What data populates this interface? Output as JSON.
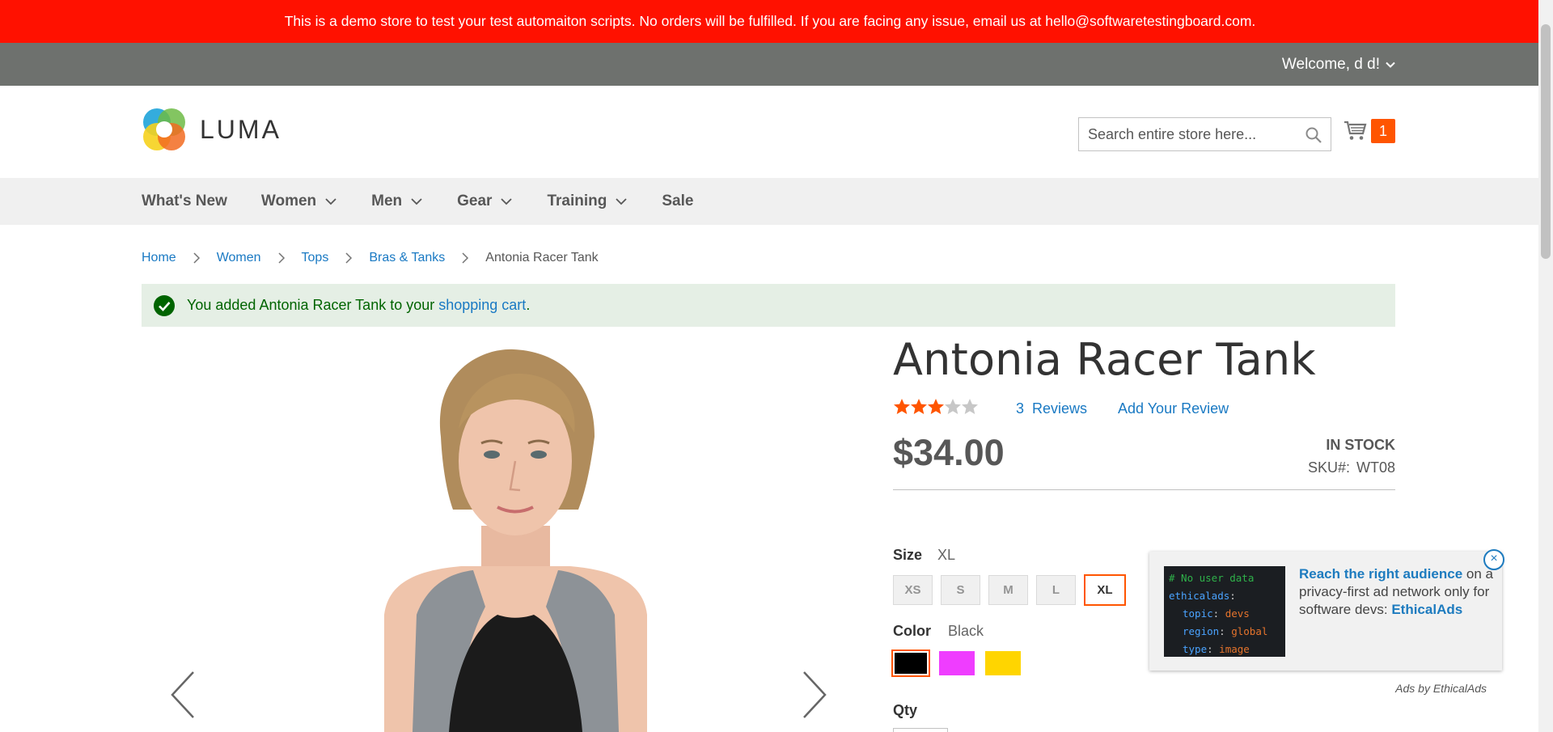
{
  "demo_notice": "This is a demo store to test your test automaiton scripts. No orders will be fulfilled. If you are facing any issue, email us at hello@softwaretestingboard.com.",
  "header": {
    "welcome": "Welcome, d d!",
    "logo_text": "LUMA",
    "search_placeholder": "Search entire store here...",
    "cart_count": "1"
  },
  "nav": {
    "items": [
      {
        "label": "What's New"
      },
      {
        "label": "Women"
      },
      {
        "label": "Men"
      },
      {
        "label": "Gear"
      },
      {
        "label": "Training"
      },
      {
        "label": "Sale"
      }
    ]
  },
  "breadcrumbs": {
    "items": [
      "Home",
      "Women",
      "Tops",
      "Bras & Tanks"
    ],
    "current": "Antonia Racer Tank"
  },
  "message": {
    "text_before": "You added Antonia Racer Tank to your ",
    "link": "shopping cart",
    "text_after": "."
  },
  "product": {
    "title": "Antonia Racer Tank",
    "rating_stars": 3,
    "rating_max": 5,
    "reviews_count": "3",
    "reviews_label": "Reviews",
    "add_review": "Add Your Review",
    "price": "$34.00",
    "stock": "In stock",
    "sku_label": "SKU#:",
    "sku": "WT08",
    "size_label": "Size",
    "size_selected": "XL",
    "sizes": [
      "XS",
      "S",
      "M",
      "L",
      "XL"
    ],
    "color_label": "Color",
    "color_selected": "Black",
    "colors": [
      "#000000",
      "#ef3dff",
      "#ffd500"
    ],
    "qty_label": "Qty"
  },
  "ad": {
    "code_comment": "# No user data",
    "code_root": "ethicalads",
    "code_topic_key": "topic",
    "code_topic_val": "devs",
    "code_region_key": "region",
    "code_region_val": "global",
    "code_type_key": "type",
    "code_type_val": "image",
    "headline": "Reach the right audience",
    "body": " on a privacy-first ad network only for software devs: ",
    "brand": "EthicalAds",
    "close": "×",
    "by": "Ads by EthicalAds"
  },
  "colors": {
    "accent": "#ff5501",
    "link": "#1979c3",
    "demo_bar": "#ff1100"
  }
}
